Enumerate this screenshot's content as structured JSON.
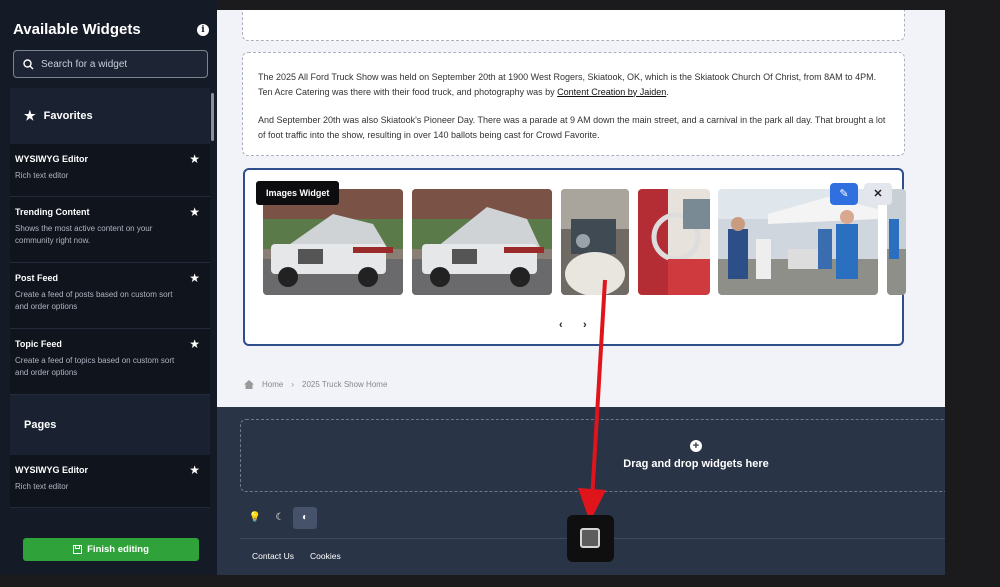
{
  "sidebar": {
    "title": "Available Widgets",
    "search_placeholder": "Search for a widget",
    "favorites_label": "Favorites",
    "pages_label": "Pages",
    "items": [
      {
        "name": "WYSIWYG Editor",
        "desc": "Rich text editor"
      },
      {
        "name": "Trending Content",
        "desc": "Shows the most active content on your community right now."
      },
      {
        "name": "Post Feed",
        "desc": "Create a feed of posts based on custom sort and order options"
      },
      {
        "name": "Topic Feed",
        "desc": "Create a feed of topics based on custom sort and order options"
      }
    ],
    "pages_items": [
      {
        "name": "WYSIWYG Editor",
        "desc": "Rich text editor"
      }
    ],
    "finish_label": "Finish editing"
  },
  "content": {
    "para1_before": "The 2025 All Ford Truck Show was held on September 20th at 1900 West Rogers, Skiatook, OK, which is the Skiatook Church Of Christ, from 8AM to 4PM.  Ten Acre Catering was there with their food truck, and photography was by ",
    "para1_link": "Content Creation by Jaiden",
    "para1_after": ".",
    "para2": "And September 20th was also Skiatook's Pioneer Day.  There was a parade at 9 AM down the main street, and a carnival in the park all day.  That brought a lot of foot traffic into the show, resulting in over 140 ballots being cast for Crowd Favorite.",
    "images_widget_label": "Images Widget",
    "prev": "‹",
    "next": "›"
  },
  "breadcrumb": {
    "home": "Home",
    "current": "2025 Truck Show Home"
  },
  "footer": {
    "drop_text": "Drag and drop widgets here",
    "contact": "Contact Us",
    "cookies": "Cookies"
  },
  "colors": {
    "accent": "#2f6fe0",
    "finish": "#2fa33a",
    "arrow": "#e0141b"
  }
}
